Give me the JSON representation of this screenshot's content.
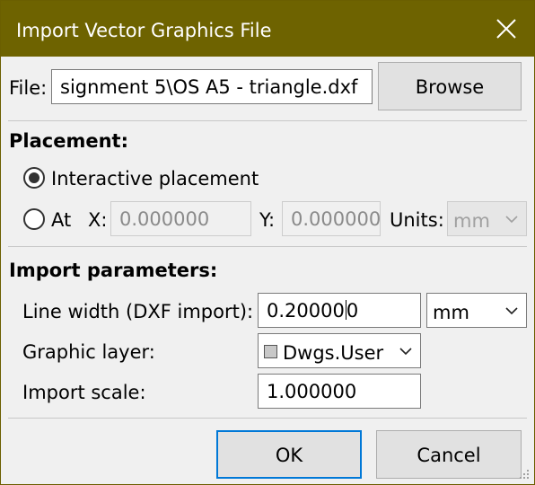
{
  "dialog": {
    "title": "Import Vector Graphics File"
  },
  "file": {
    "label": "File:",
    "value": "signment 5\\OS A5 - triangle.dxf",
    "browse_label": "Browse"
  },
  "placement": {
    "heading": "Placement:",
    "interactive_label": "Interactive placement",
    "at_label": "At",
    "x_label": "X:",
    "x_value": "0.000000",
    "y_label": "Y:",
    "y_value": "0.000000",
    "units_label": "Units:",
    "units_value": "mm",
    "selected": "interactive"
  },
  "import_params": {
    "heading": "Import parameters:",
    "line_width_label": "Line width (DXF import):",
    "line_width_value_a": "0.20000",
    "line_width_value_b": "0",
    "line_width_unit": "mm",
    "layer_label": "Graphic layer:",
    "layer_value": "Dwgs.User",
    "scale_label": "Import scale:",
    "scale_value": "1.000000"
  },
  "buttons": {
    "ok_label": "OK",
    "cancel_label": "Cancel"
  },
  "colors": {
    "titlebar": "#6e6300",
    "accent": "#0078d7"
  },
  "icons": {
    "close": "close-icon",
    "dropdown": "chevron-down-icon",
    "grip": "resize-grip-icon"
  }
}
